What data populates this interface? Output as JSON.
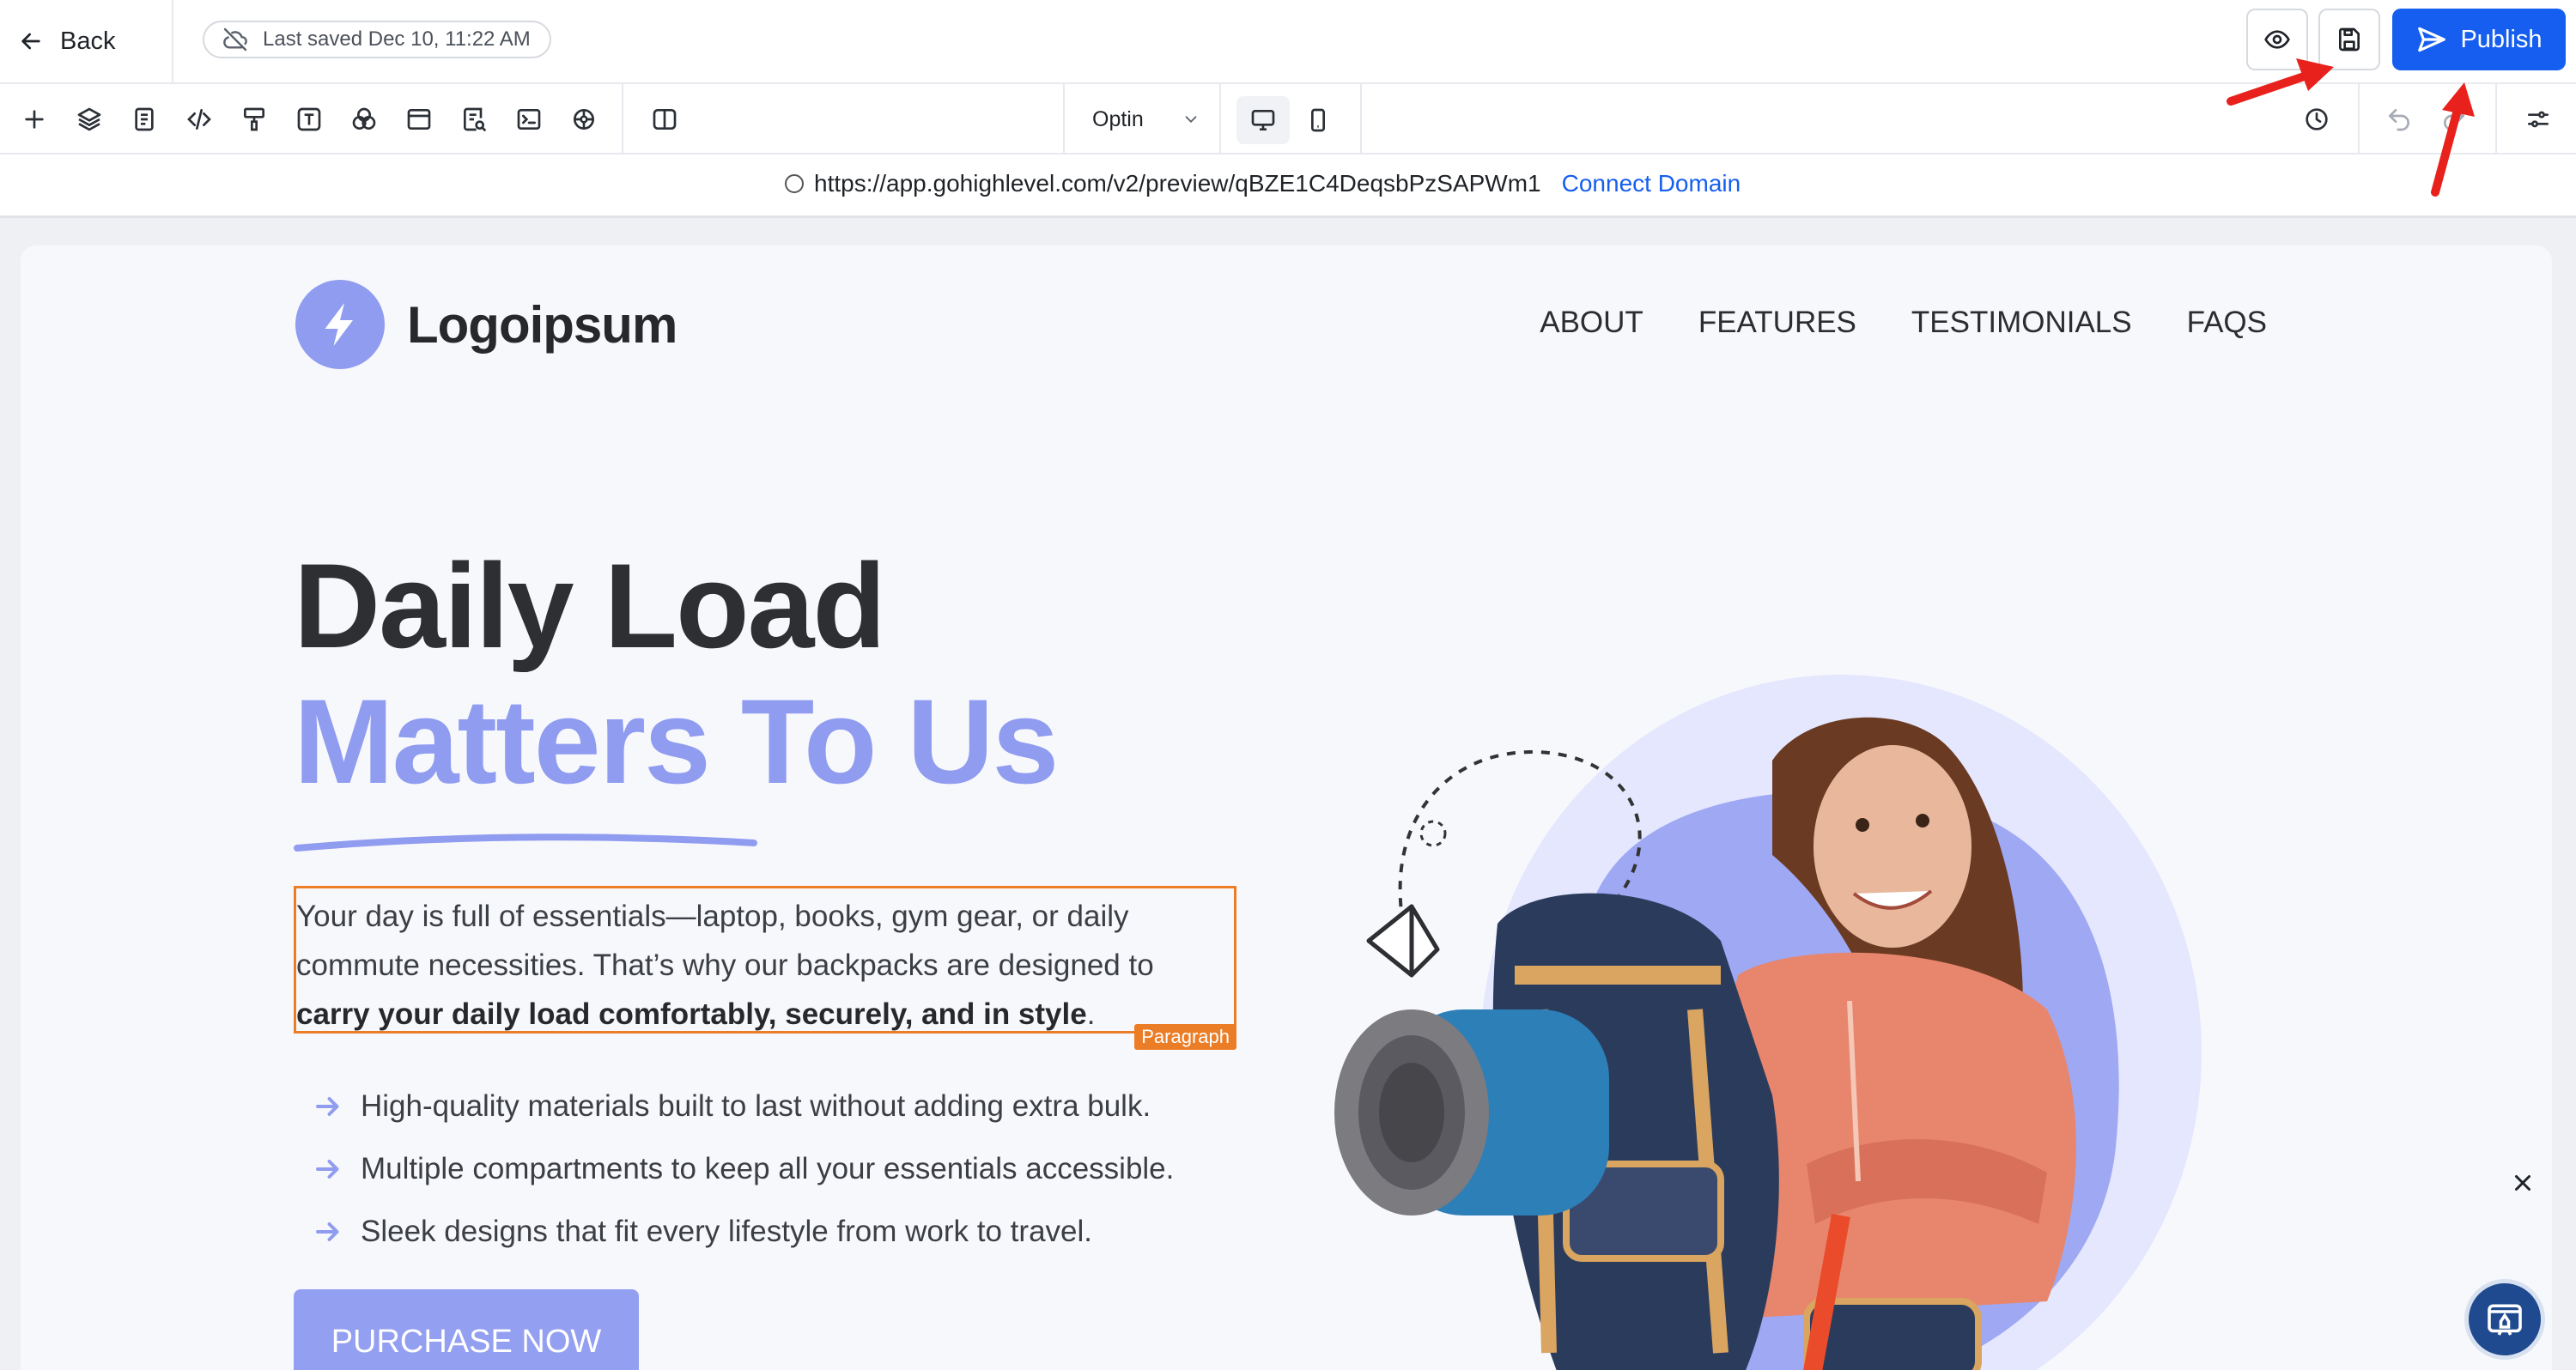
{
  "header": {
    "back_label": "Back",
    "saved_status": "Last saved Dec 10, 11:22 AM",
    "publish_label": "Publish"
  },
  "toolbar": {
    "page_select": "Optin"
  },
  "urlbar": {
    "url": "https://app.gohighlevel.com/v2/preview/qBZE1C4DeqsbPzSAPWm1",
    "connect_label": "Connect Domain"
  },
  "site": {
    "logo_text": "Logoipsum",
    "nav": [
      "ABOUT",
      "FEATURES",
      "TESTIMONIALS",
      "FAQS"
    ],
    "headline_1": "Daily Load",
    "headline_2": "Matters To Us",
    "paragraph_plain": "Your day is full of essentials—laptop, books, gym gear, or daily commute necessities. That’s why our backpacks are designed to ",
    "paragraph_bold": "carry your daily load comfortably, securely, and in style",
    "paragraph_end": ".",
    "selection_tag": "Paragraph",
    "features": [
      "High-quality materials built to last without adding extra bulk.",
      "Multiple compartments to keep all your essentials accessible.",
      "Sleek designs that fit every lifestyle from work to travel."
    ],
    "cta_label": "PURCHASE NOW"
  },
  "colors": {
    "accent": "#8f9cf0",
    "primary_button": "#155eef",
    "selection": "#ec7d27",
    "annotation_arrow": "#e8211d"
  },
  "icons": {
    "toolbar": [
      "add-icon",
      "layers-icon",
      "pages-icon",
      "code-icon",
      "paint-icon",
      "typography-icon",
      "colors-icon",
      "layout-icon",
      "search-page-icon",
      "terminal-icon",
      "settings-wheel-icon",
      "columns-icon"
    ]
  }
}
